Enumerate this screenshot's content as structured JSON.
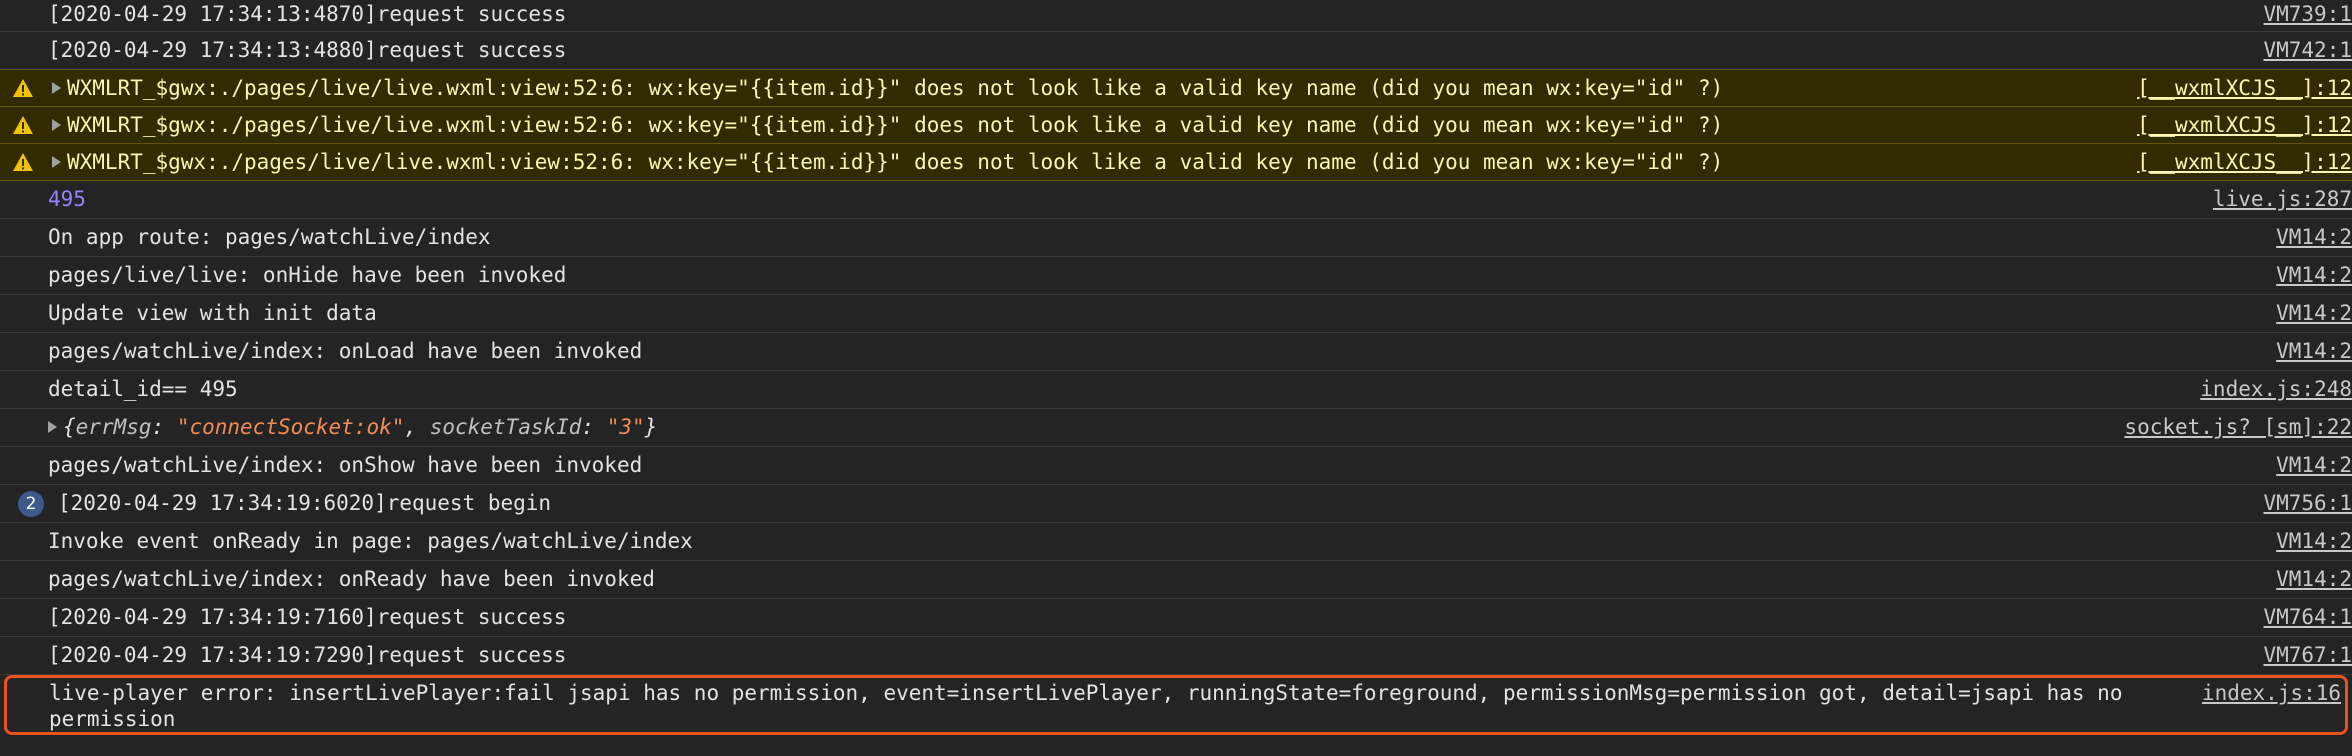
{
  "console": {
    "rows": [
      {
        "type": "log",
        "text": "[2020-04-29 17:34:13:4870]request success",
        "source": "VM739:1"
      },
      {
        "type": "log",
        "text": "[2020-04-29 17:34:13:4880]request success",
        "source": "VM742:1"
      },
      {
        "type": "warn",
        "text": "WXMLRT_$gwx:./pages/live/live.wxml:view:52:6: wx:key=\"{{item.id}}\" does not look like a valid key name (did you mean wx:key=\"id\" ?)",
        "source": "[__wxmlXCJS__]:12"
      },
      {
        "type": "warn",
        "text": "WXMLRT_$gwx:./pages/live/live.wxml:view:52:6: wx:key=\"{{item.id}}\" does not look like a valid key name (did you mean wx:key=\"id\" ?)",
        "source": "[__wxmlXCJS__]:12"
      },
      {
        "type": "warn",
        "text": "WXMLRT_$gwx:./pages/live/live.wxml:view:52:6: wx:key=\"{{item.id}}\" does not look like a valid key name (did you mean wx:key=\"id\" ?)",
        "source": "[__wxmlXCJS__]:12"
      },
      {
        "type": "number",
        "text": "495",
        "source": "live.js:287"
      },
      {
        "type": "log",
        "text": "On app route: pages/watchLive/index",
        "source": "VM14:2"
      },
      {
        "type": "log",
        "text": "pages/live/live: onHide have been invoked",
        "source": "VM14:2"
      },
      {
        "type": "log",
        "text": "Update view with init data",
        "source": "VM14:2"
      },
      {
        "type": "log",
        "text": "pages/watchLive/index: onLoad have been invoked",
        "source": "VM14:2"
      },
      {
        "type": "log",
        "text": "detail_id== 495",
        "source": "index.js:248"
      },
      {
        "type": "object",
        "open": "{",
        "k1": "errMsg",
        "colon1": ": ",
        "v1": "\"connectSocket:ok\"",
        "sep": ", ",
        "k2": "socketTaskId",
        "colon2": ": ",
        "v2": "\"3\"",
        "close": "}",
        "source": "socket.js? [sm]:22"
      },
      {
        "type": "log",
        "text": "pages/watchLive/index: onShow have been invoked",
        "source": "VM14:2"
      },
      {
        "type": "badge",
        "count": "2",
        "text": "[2020-04-29 17:34:19:6020]request begin",
        "source": "VM756:1"
      },
      {
        "type": "log",
        "text": "Invoke event onReady in page: pages/watchLive/index",
        "source": "VM14:2"
      },
      {
        "type": "log",
        "text": "pages/watchLive/index: onReady have been invoked",
        "source": "VM14:2"
      },
      {
        "type": "log",
        "text": "[2020-04-29 17:34:19:7160]request success",
        "source": "VM764:1"
      },
      {
        "type": "log",
        "text": "[2020-04-29 17:34:19:7290]request success",
        "source": "VM767:1"
      },
      {
        "type": "error",
        "text": "live-player error: insertLivePlayer:fail jsapi has no permission, event=insertLivePlayer, runningState=foreground, permissionMsg=permission got, detail=jsapi has no permission",
        "source": "index.js:16"
      }
    ]
  },
  "colors": {
    "background": "#242424",
    "warning_bg": "#332b00",
    "warning_text": "#fdf5b0",
    "number": "#9980ff",
    "string": "#f28b54",
    "highlight_border": "#e8531f",
    "badge": "#3d5a8a"
  },
  "icons": {
    "warning": "warning-triangle-icon",
    "expand": "expand-triangle-icon"
  }
}
